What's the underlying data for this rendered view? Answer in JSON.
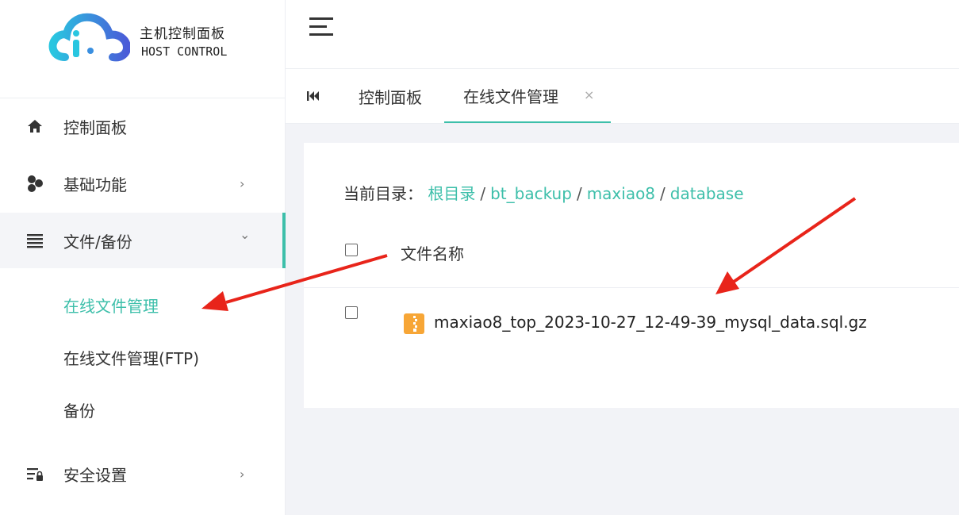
{
  "logo": {
    "title_cn": "主机控制面板",
    "title_en": "HOST CONTROL"
  },
  "sidebar": {
    "items": [
      {
        "label": "控制面板",
        "icon": "home-icon"
      },
      {
        "label": "基础功能",
        "icon": "cluster-icon",
        "chevron": "›"
      },
      {
        "label": "文件/备份",
        "icon": "list-icon",
        "chevron": "⌄"
      },
      {
        "label": "安全设置",
        "icon": "security-settings-icon",
        "chevron": "›"
      }
    ],
    "sub_items": [
      {
        "label": "在线文件管理"
      },
      {
        "label": "在线文件管理(FTP)"
      },
      {
        "label": "备份"
      }
    ]
  },
  "tabs": [
    {
      "label": "控制面板"
    },
    {
      "label": "在线文件管理"
    }
  ],
  "tab_close": "×",
  "breadcrumb": {
    "prefix": "当前目录：",
    "parts": [
      "根目录",
      "bt_backup",
      "maxiao8",
      "database"
    ],
    "separator": "/"
  },
  "table": {
    "header": "文件名称",
    "rows": [
      {
        "name": "maxiao8_top_2023-10-27_12-49-39_mysql_data.sql.gz",
        "icon": "zip-file-icon"
      }
    ]
  },
  "colors": {
    "accent": "#3dbfaa",
    "arrow": "#e8241a",
    "file_icon": "#f7a636"
  }
}
